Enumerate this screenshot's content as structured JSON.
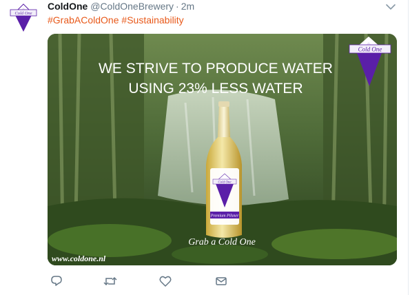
{
  "tweet": {
    "author_name": "ColdOne",
    "author_handle": "@ColdOneBrewery",
    "separator": "·",
    "time": "2m",
    "hashtags": [
      "#GrabAColdOne",
      "#Sustainability"
    ]
  },
  "avatar": {
    "logo_text": "Cold One"
  },
  "media": {
    "headline_line1": "WE STRIVE TO PRODUCE WATER",
    "headline_line2": "USING 23% LESS WATER",
    "corner_logo_text": "Cold One",
    "bottle_top_label": "Cold One",
    "bottle_bottom_label": "Premium Pilsner",
    "tagline": "Grab a Cold One",
    "website": "www.coldone.nl"
  },
  "actions": [
    "reply-icon",
    "retweet-icon",
    "like-icon",
    "message-icon"
  ],
  "colors": {
    "hashtag": "#e8591a",
    "brand_purple": "#5a1fa8",
    "muted_text": "#657786",
    "name_text": "#14171a"
  }
}
